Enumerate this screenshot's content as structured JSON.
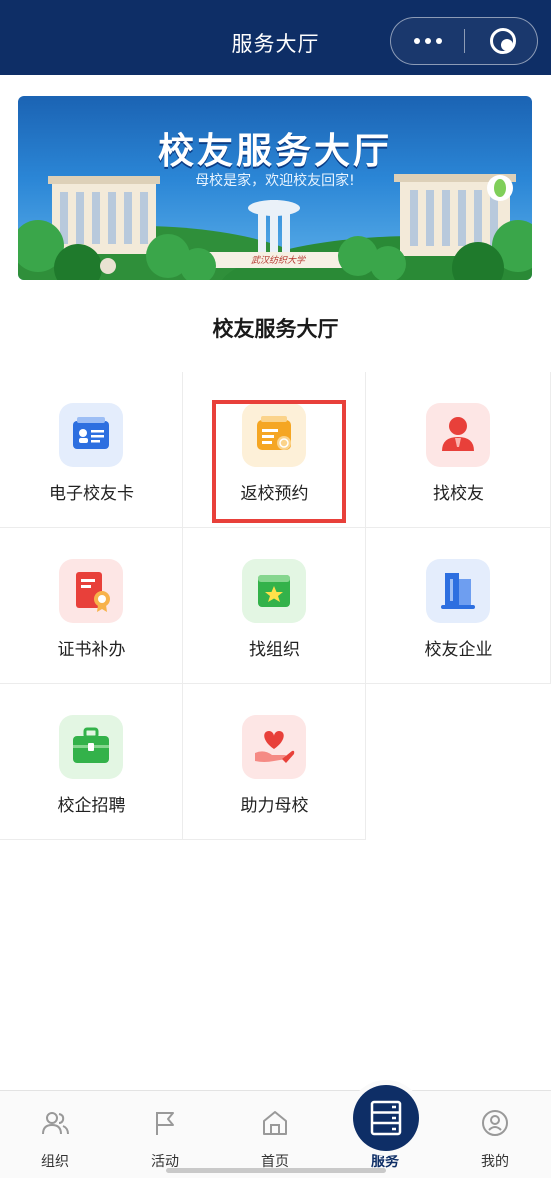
{
  "header": {
    "title": "服务大厅"
  },
  "banner": {
    "title": "校友服务大厅",
    "subtitle": "母校是家，欢迎校友回家!",
    "gate_text": "武汉纺织大学"
  },
  "section": {
    "title": "校友服务大厅"
  },
  "services": [
    {
      "label": "电子校友卡",
      "icon": "id-card-icon",
      "color": "#2d6fe0"
    },
    {
      "label": "返校预约",
      "icon": "calendar-icon",
      "color": "#f5a623"
    },
    {
      "label": "找校友",
      "icon": "person-icon",
      "color": "#e8403a"
    },
    {
      "label": "证书补办",
      "icon": "certificate-icon",
      "color": "#e8403a"
    },
    {
      "label": "找组织",
      "icon": "organization-icon",
      "color": "#33b24a"
    },
    {
      "label": "校友企业",
      "icon": "building-icon",
      "color": "#2d6fe0"
    },
    {
      "label": "校企招聘",
      "icon": "briefcase-icon",
      "color": "#33b24a"
    },
    {
      "label": "助力母校",
      "icon": "heart-hand-icon",
      "color": "#e8403a"
    }
  ],
  "tabbar": {
    "items": [
      {
        "label": "组织",
        "icon": "people-icon"
      },
      {
        "label": "活动",
        "icon": "flag-icon"
      },
      {
        "label": "首页",
        "icon": "home-icon"
      },
      {
        "label": "服务",
        "icon": "server-icon",
        "active": true
      },
      {
        "label": "我的",
        "icon": "user-circle-icon"
      }
    ]
  },
  "colors": {
    "header": "#0e2e66",
    "highlight": "#e8403a"
  }
}
